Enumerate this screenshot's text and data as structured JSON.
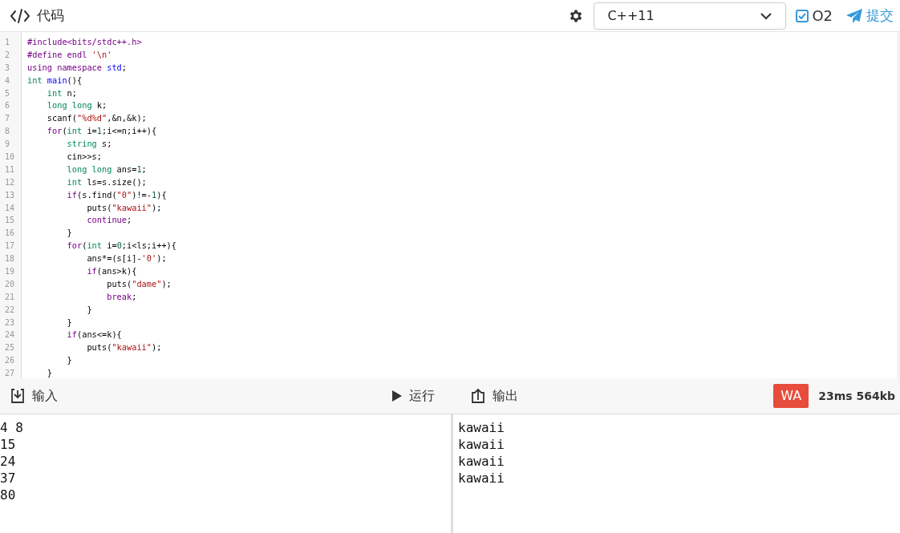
{
  "header": {
    "title": "代码",
    "language": "C++11",
    "o2": {
      "label": "O2",
      "checked": true
    },
    "submit": "提交"
  },
  "code": [
    {
      "num": "1",
      "tokens": [
        {
          "kind": "meta",
          "text": "#include<bits/stdc++.h>"
        }
      ]
    },
    {
      "num": "2",
      "tokens": [
        {
          "kind": "meta",
          "text": "#define endl"
        },
        {
          "kind": "string",
          "text": " '\\n'"
        }
      ]
    },
    {
      "num": "3",
      "tokens": [
        {
          "kind": "keyword",
          "text": "using"
        },
        {
          "kind": "keyword",
          "text": " namespace"
        },
        {
          "kind": "def",
          "text": " std"
        },
        {
          "kind": "plain",
          "text": ";"
        }
      ]
    },
    {
      "num": "4",
      "tokens": [
        {
          "kind": "type",
          "text": "int"
        },
        {
          "kind": "def",
          "text": " main"
        },
        {
          "kind": "plain",
          "text": "(){"
        }
      ]
    },
    {
      "num": "5",
      "tokens": [
        {
          "kind": "type",
          "text": "    int"
        },
        {
          "kind": "plain",
          "text": " n;"
        }
      ]
    },
    {
      "num": "6",
      "tokens": [
        {
          "kind": "type",
          "text": "    long"
        },
        {
          "kind": "type",
          "text": " long"
        },
        {
          "kind": "plain",
          "text": " k;"
        }
      ]
    },
    {
      "num": "7",
      "tokens": [
        {
          "kind": "plain",
          "text": "    scanf("
        },
        {
          "kind": "string",
          "text": "\"%d%d\""
        },
        {
          "kind": "plain",
          "text": ",&n,&k);"
        }
      ]
    },
    {
      "num": "8",
      "tokens": [
        {
          "kind": "keyword",
          "text": "    for"
        },
        {
          "kind": "plain",
          "text": "("
        },
        {
          "kind": "type",
          "text": "int"
        },
        {
          "kind": "plain",
          "text": " i="
        },
        {
          "kind": "number",
          "text": "1"
        },
        {
          "kind": "plain",
          "text": ";i<=n;i++){"
        }
      ]
    },
    {
      "num": "9",
      "tokens": [
        {
          "kind": "type",
          "text": "        string"
        },
        {
          "kind": "plain",
          "text": " s;"
        }
      ]
    },
    {
      "num": "10",
      "tokens": [
        {
          "kind": "plain",
          "text": "        cin>>s;"
        }
      ]
    },
    {
      "num": "11",
      "tokens": [
        {
          "kind": "type",
          "text": "        long"
        },
        {
          "kind": "type",
          "text": " long"
        },
        {
          "kind": "plain",
          "text": " ans="
        },
        {
          "kind": "number",
          "text": "1"
        },
        {
          "kind": "plain",
          "text": ";"
        }
      ]
    },
    {
      "num": "12",
      "tokens": [
        {
          "kind": "type",
          "text": "        int"
        },
        {
          "kind": "plain",
          "text": " ls=s.size();"
        }
      ]
    },
    {
      "num": "13",
      "tokens": [
        {
          "kind": "keyword",
          "text": "        if"
        },
        {
          "kind": "plain",
          "text": "(s.find("
        },
        {
          "kind": "string",
          "text": "\"0\""
        },
        {
          "kind": "plain",
          "text": ")!=-"
        },
        {
          "kind": "number",
          "text": "1"
        },
        {
          "kind": "plain",
          "text": "){"
        }
      ]
    },
    {
      "num": "14",
      "tokens": [
        {
          "kind": "plain",
          "text": "            puts("
        },
        {
          "kind": "string",
          "text": "\"kawaii\""
        },
        {
          "kind": "plain",
          "text": ");"
        }
      ]
    },
    {
      "num": "15",
      "tokens": [
        {
          "kind": "keyword",
          "text": "            continue"
        },
        {
          "kind": "plain",
          "text": ";"
        }
      ]
    },
    {
      "num": "16",
      "tokens": [
        {
          "kind": "plain",
          "text": "        }"
        }
      ]
    },
    {
      "num": "17",
      "tokens": [
        {
          "kind": "keyword",
          "text": "        for"
        },
        {
          "kind": "plain",
          "text": "("
        },
        {
          "kind": "type",
          "text": "int"
        },
        {
          "kind": "plain",
          "text": " i="
        },
        {
          "kind": "number",
          "text": "0"
        },
        {
          "kind": "plain",
          "text": ";i<ls;i++){"
        }
      ]
    },
    {
      "num": "18",
      "tokens": [
        {
          "kind": "plain",
          "text": "            ans*=(s[i]-"
        },
        {
          "kind": "string",
          "text": "'0'"
        },
        {
          "kind": "plain",
          "text": ");"
        }
      ]
    },
    {
      "num": "19",
      "tokens": [
        {
          "kind": "keyword",
          "text": "            if"
        },
        {
          "kind": "plain",
          "text": "(ans>k){"
        }
      ]
    },
    {
      "num": "20",
      "tokens": [
        {
          "kind": "plain",
          "text": "                puts("
        },
        {
          "kind": "string",
          "text": "\"dame\""
        },
        {
          "kind": "plain",
          "text": ");"
        }
      ]
    },
    {
      "num": "21",
      "tokens": [
        {
          "kind": "keyword",
          "text": "                break"
        },
        {
          "kind": "plain",
          "text": ";"
        }
      ]
    },
    {
      "num": "22",
      "tokens": [
        {
          "kind": "plain",
          "text": "            }"
        }
      ]
    },
    {
      "num": "23",
      "tokens": [
        {
          "kind": "plain",
          "text": "        }"
        }
      ]
    },
    {
      "num": "24",
      "tokens": [
        {
          "kind": "keyword",
          "text": "        if"
        },
        {
          "kind": "plain",
          "text": "(ans<=k){"
        }
      ]
    },
    {
      "num": "25",
      "tokens": [
        {
          "kind": "plain",
          "text": "            puts("
        },
        {
          "kind": "string",
          "text": "\"kawaii\""
        },
        {
          "kind": "plain",
          "text": ");"
        }
      ]
    },
    {
      "num": "26",
      "tokens": [
        {
          "kind": "plain",
          "text": "        }"
        }
      ]
    },
    {
      "num": "27",
      "tokens": [
        {
          "kind": "plain",
          "text": "    }"
        }
      ]
    }
  ],
  "toolbar": {
    "input_label": "输入",
    "run": "运行",
    "output_label": "输出",
    "verdict": "WA",
    "stats": "23ms 564kb"
  },
  "input_lines": [
    "4 8",
    "15",
    "24",
    "37",
    "80"
  ],
  "output_lines": [
    "kawaii",
    "kawaii",
    "kawaii",
    "kawaii"
  ]
}
